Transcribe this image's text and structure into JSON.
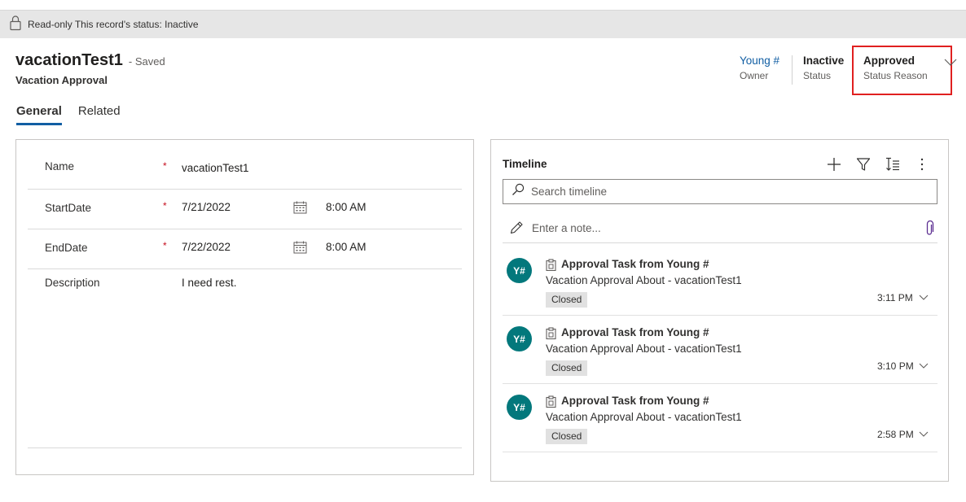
{
  "readonly_bar": {
    "message": "Read-only This record's status: Inactive"
  },
  "record": {
    "name": "vacationTest1",
    "saved_state": "- Saved",
    "entity": "Vacation Approval"
  },
  "header_fields": {
    "owner": {
      "value": "Young #",
      "label": "Owner"
    },
    "status": {
      "value": "Inactive",
      "label": "Status"
    },
    "status_reason": {
      "value": "Approved",
      "label": "Status Reason"
    }
  },
  "tabs": [
    {
      "label": "General",
      "active": true
    },
    {
      "label": "Related",
      "active": false
    }
  ],
  "form": {
    "required_marker": "*",
    "name": {
      "label": "Name",
      "value": "vacationTest1"
    },
    "start_date": {
      "label": "StartDate",
      "date": "7/21/2022",
      "time": "8:00 AM"
    },
    "end_date": {
      "label": "EndDate",
      "date": "7/22/2022",
      "time": "8:00 AM"
    },
    "description": {
      "label": "Description",
      "value": "I need rest."
    }
  },
  "timeline": {
    "title": "Timeline",
    "search_placeholder": "Search timeline",
    "note_placeholder": "Enter a note...",
    "entries": [
      {
        "initials": "Y#",
        "title": "Approval Task from Young #",
        "description": "Vacation Approval About - vacationTest1",
        "status": "Closed",
        "time": "3:11 PM"
      },
      {
        "initials": "Y#",
        "title": "Approval Task from Young #",
        "description": "Vacation Approval About - vacationTest1",
        "status": "Closed",
        "time": "3:10 PM"
      },
      {
        "initials": "Y#",
        "title": "Approval Task from Young #",
        "description": "Vacation Approval About - vacationTest1",
        "status": "Closed",
        "time": "2:58 PM"
      }
    ]
  },
  "colors": {
    "accent": "#115ea3",
    "avatar": "#03787c",
    "highlight_box": "#e02020",
    "required": "#c50f1f"
  },
  "icons": [
    "lock-icon",
    "calendar-icon",
    "plus-icon",
    "filter-icon",
    "sort-icon",
    "more-icon",
    "search-icon",
    "pencil-icon",
    "paperclip-icon",
    "task-icon",
    "chevron-down-icon"
  ]
}
